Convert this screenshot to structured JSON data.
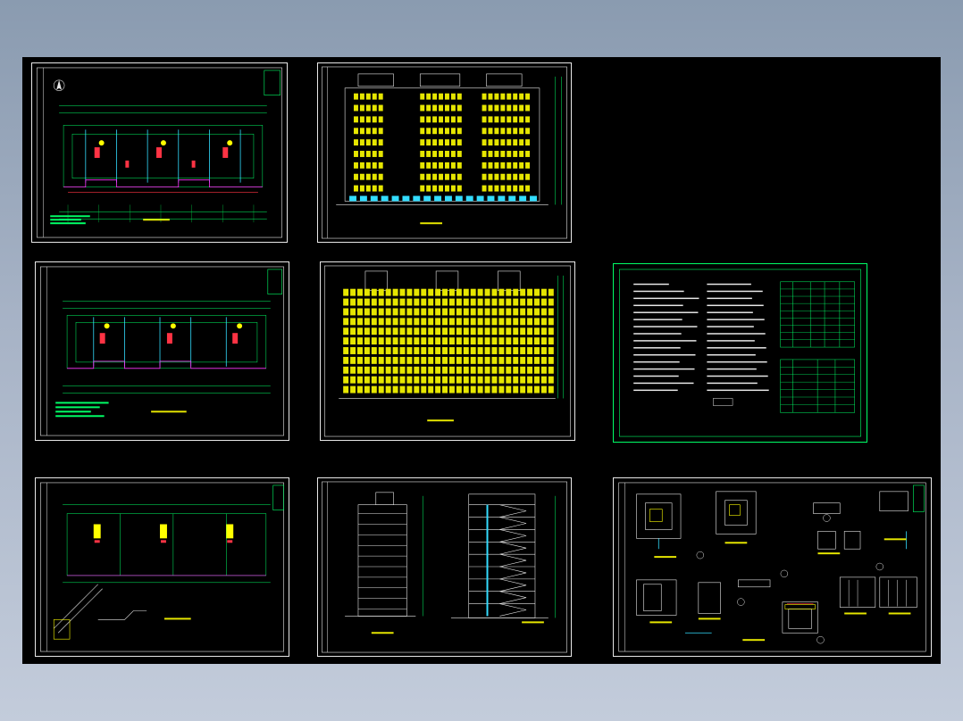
{
  "viewport": {
    "background_top": "#8a9bb0",
    "background_bottom": "#c3ccdb",
    "drawing_area_color": "#000000"
  },
  "colors": {
    "frame": "#e8e8e8",
    "wall": "#00ff66",
    "dim": "#00cc44",
    "accent_red": "#ff3344",
    "accent_magenta": "#ff33ff",
    "accent_cyan": "#33ddff",
    "accent_yellow": "#ffff00",
    "facade": "#e6e600"
  },
  "sheets": [
    {
      "id": "sheet-floor-plan-1",
      "kind": "floor-plan",
      "icon": "north-arrow-icon"
    },
    {
      "id": "sheet-front-elevation",
      "kind": "elevation"
    },
    {
      "id": "sheet-floor-plan-2",
      "kind": "floor-plan"
    },
    {
      "id": "sheet-rear-elevation",
      "kind": "elevation"
    },
    {
      "id": "sheet-design-notes",
      "kind": "notes-table"
    },
    {
      "id": "sheet-roof-plan",
      "kind": "floor-plan"
    },
    {
      "id": "sheet-side-elevation-section",
      "kind": "elevation-section"
    },
    {
      "id": "sheet-details",
      "kind": "detail-drawings"
    }
  ]
}
